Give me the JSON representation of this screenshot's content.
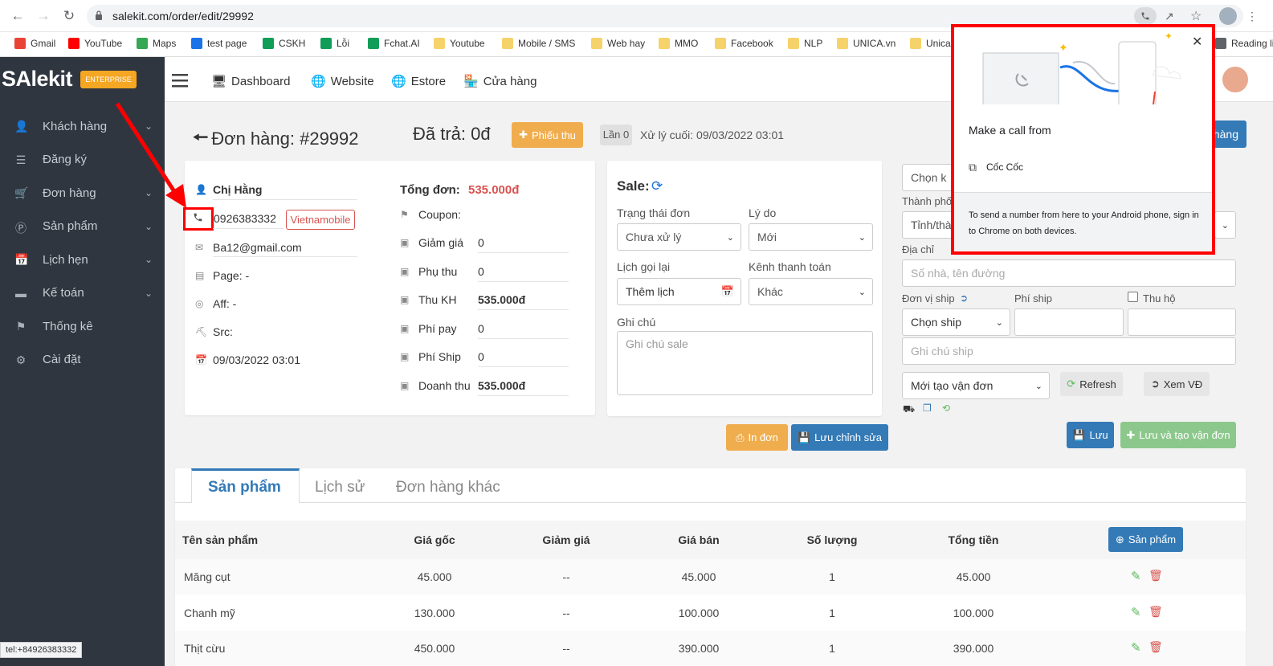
{
  "browser": {
    "url": "salekit.com/order/edit/29992",
    "status": "tel:+84926383332"
  },
  "bookmarks": [
    {
      "label": "Gmail",
      "color": "#ea4335"
    },
    {
      "label": "YouTube",
      "color": "#ff0000"
    },
    {
      "label": "Maps",
      "color": "#34a853"
    },
    {
      "label": "test page",
      "color": "#1a73e8"
    },
    {
      "label": "CSKH",
      "color": "#0f9d58"
    },
    {
      "label": "Lỗi",
      "color": "#0f9d58"
    },
    {
      "label": "Fchat.AI",
      "color": "#0f9d58"
    },
    {
      "label": "Youtube",
      "color": "#f6d26b"
    },
    {
      "label": "Mobile / SMS",
      "color": "#f6d26b"
    },
    {
      "label": "Web hay",
      "color": "#f6d26b"
    },
    {
      "label": "MMO",
      "color": "#f6d26b"
    },
    {
      "label": "Facebook",
      "color": "#f6d26b"
    },
    {
      "label": "NLP",
      "color": "#f6d26b"
    },
    {
      "label": "UNICA.vn",
      "color": "#f6d26b"
    },
    {
      "label": "Unica",
      "color": "#f6d26b"
    },
    {
      "label": "Reading list",
      "color": "#5f6368"
    }
  ],
  "logo": {
    "text": "SAlekit",
    "badge": "ENTERPRISE"
  },
  "sidebar": [
    {
      "label": "Khách hàng",
      "icon": "user-icon",
      "chevron": true
    },
    {
      "label": "Đăng ký",
      "icon": "list-icon",
      "chevron": false
    },
    {
      "label": "Đơn hàng",
      "icon": "cart-icon",
      "chevron": true
    },
    {
      "label": "Sản phẩm",
      "icon": "product-icon",
      "chevron": true
    },
    {
      "label": "Lịch hẹn",
      "icon": "calendar-icon",
      "chevron": true
    },
    {
      "label": "Kế toán",
      "icon": "card-icon",
      "chevron": true
    },
    {
      "label": "Thống kê",
      "icon": "flag-icon",
      "chevron": false
    },
    {
      "label": "Cài đặt",
      "icon": "gear-icon",
      "chevron": false
    }
  ],
  "topnav": {
    "dashboard": "Dashboard",
    "website": "Website",
    "estore": "Estore",
    "store": "Cửa hàng"
  },
  "order": {
    "title": "Đơn hàng: #29992",
    "paid": "Đã trả: 0đ",
    "receipt_btn": "Phiếu thu",
    "times": "Lần 0",
    "last_processed": "Xử lý cuối: 09/03/2022 03:01",
    "right_btn": "hàng"
  },
  "customer": {
    "name": "Chị Hằng",
    "phone": "0926383332",
    "carrier": "Vietnamobile",
    "email": "Ba12@gmail.com",
    "page": "Page: -",
    "aff": "Aff: -",
    "src": "Src:",
    "date": "09/03/2022 03:01"
  },
  "totals": {
    "total_label": "Tổng đơn:",
    "total_value": "535.000đ",
    "coupon": "Coupon:",
    "rows": [
      {
        "label": "Giảm giá",
        "value": "0",
        "bold": false
      },
      {
        "label": "Phụ thu",
        "value": "0",
        "bold": false
      },
      {
        "label": "Thu KH",
        "value": "535.000đ",
        "bold": true
      },
      {
        "label": "Phí pay",
        "value": "0",
        "bold": false
      },
      {
        "label": "Phí Ship",
        "value": "0",
        "bold": false
      },
      {
        "label": "Doanh thu",
        "value": "535.000đ",
        "bold": true
      }
    ]
  },
  "sale": {
    "title": "Sale:",
    "status_label": "Trạng thái đơn",
    "status_value": "Chưa xử lý",
    "reason_label": "Lý do",
    "reason_value": "Mới",
    "recall_label": "Lịch gọi lại",
    "recall_value": "Thêm lịch",
    "payment_label": "Kênh thanh toán",
    "payment_value": "Khác",
    "note_label": "Ghi chú",
    "note_placeholder": "Ghi chú sale",
    "print_btn": "In đơn",
    "save_edit_btn": "Lưu chỉnh sửa"
  },
  "shipping": {
    "choose": "Chọn k",
    "city_label": "Thành phố",
    "city_value": "Tỉnh/thà",
    "address_label": "Địa chỉ",
    "address_placeholder": "Số nhà, tên đường",
    "ship_unit_label": "Đơn vị ship",
    "ship_fee_label": "Phí ship",
    "cod_label": "Thu hộ",
    "ship_select": "Chọn ship",
    "ship_note_placeholder": "Ghi chú ship",
    "waybill_select": "Mới tạo vận đơn",
    "refresh_btn": "Refresh",
    "view_btn": "Xem VĐ",
    "save_btn": "Lưu",
    "save_create_btn": "Lưu và tạo vận đơn"
  },
  "tabs": [
    "Sản phẩm",
    "Lịch sử",
    "Đơn hàng khác"
  ],
  "table": {
    "headers": [
      "Tên sản phẩm",
      "Giá gốc",
      "Giảm giá",
      "Giá bán",
      "Số lượng",
      "Tổng tiền"
    ],
    "add_btn": "Sản phẩm",
    "rows": [
      [
        "Măng cụt",
        "45.000",
        "--",
        "45.000",
        "1",
        "45.000"
      ],
      [
        "Chanh mỹ",
        "130.000",
        "--",
        "100.000",
        "1",
        "100.000"
      ],
      [
        "Thịt cừu",
        "450.000",
        "--",
        "390.000",
        "1",
        "390.000"
      ]
    ]
  },
  "popup": {
    "title": "Make a call from",
    "option": "Cốc Cốc",
    "footer": "To send a number from here to your Android phone, sign in to Chrome on both devices."
  },
  "colors": {
    "sidebar": "#2f3640",
    "highlight": "#ff0000",
    "primary": "#337ab7",
    "warning": "#f0ad4e",
    "success": "#5cb85c",
    "accent_red": "#d9534f"
  }
}
